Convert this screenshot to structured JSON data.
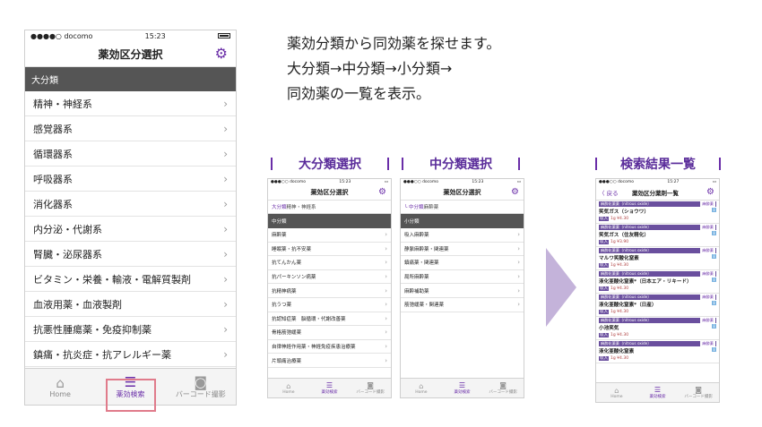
{
  "main_phone": {
    "status": {
      "carrier": "●●●●○ docomo",
      "time": "15:23"
    },
    "title": "薬効区分選択",
    "section": "大分類",
    "rows": [
      "精神・神経系",
      "感覚器系",
      "循環器系",
      "呼吸器系",
      "消化器系",
      "内分泌・代謝系",
      "腎臓・泌尿器系",
      "ビタミン・栄養・輸液・電解質製剤",
      "血液用薬・血液製剤",
      "抗悪性腫瘍薬・免疫抑制薬",
      "鎮痛・抗炎症・抗アレルギー薬"
    ],
    "tabs": [
      "Home",
      "薬効検索",
      "バーコード撮影"
    ]
  },
  "description": [
    "薬効分類から同効薬を探せます。",
    "大分類→中分類→小分類→",
    "同効薬の一覧を表示。"
  ],
  "headers": {
    "a": "大分類選択",
    "b": "中分類選択",
    "c": "検索結果一覧"
  },
  "phone_a": {
    "status": {
      "carrier": "●●●○○ docomo",
      "time": "15:23"
    },
    "title": "薬効区分選択",
    "crumb_prefix": "大分類",
    "crumb_rest": " 精神・神経系",
    "section": "中分類",
    "rows": [
      "麻酔薬",
      "睡眠薬・抗不安薬",
      "抗てんかん薬",
      "抗パーキンソン病薬",
      "抗精神病薬",
      "抗うつ薬",
      "抗認知症薬　脳循環・代謝改善薬",
      "骨格筋弛緩薬",
      "自律神経作用薬・神経免疫疾患治療薬",
      "片頭痛治療薬"
    ],
    "tabs": [
      "Home",
      "薬効検索",
      "バーコード撮影"
    ]
  },
  "phone_b": {
    "status": {
      "carrier": "●●●○○ docomo",
      "time": "15:23"
    },
    "title": "薬効区分選択",
    "crumb_prefix": "└ 中分類",
    "crumb_rest": " 麻酔薬",
    "section": "小分類",
    "rows": [
      "吸入麻酔薬",
      "静脈麻酔薬・関連薬",
      "鎮痛薬・関連薬",
      "局所麻酔薬",
      "麻酔補助薬",
      "筋弛緩薬・関連薬"
    ],
    "tabs": [
      "Home",
      "薬効検索",
      "バーコード撮影"
    ]
  },
  "phone_c": {
    "status": {
      "carrier": "●●●○○ docomo",
      "time": "15:27"
    },
    "back": "〈 戻る",
    "title": "薬効区分薬剤一覧",
    "results": [
      {
        "cat": "麻酔化薬薬（nitrous oxide）",
        "tag": "麻酔薬",
        "name": "笑気ガス（ショウワ）",
        "price": "¥4.30"
      },
      {
        "cat": "麻酔化薬薬（nitrous oxide）",
        "tag": "麻酔薬",
        "name": "笑気ガス（住友精化）",
        "price": "¥3.90"
      },
      {
        "cat": "麻酔化薬薬（nitrous oxide）",
        "tag": "麻酔薬",
        "name": "マルワ笑酸化窒素",
        "price": "¥4.30"
      },
      {
        "cat": "麻酔化薬薬（nitrous oxide）",
        "tag": "麻酔薬",
        "name": "液化亜酸化窒素*（日本エア・リキード）",
        "price": "¥4.30"
      },
      {
        "cat": "麻酔化薬薬（nitrous oxide）",
        "tag": "麻酔薬",
        "name": "液化亜酸化窒素*（日産）",
        "price": "¥4.30"
      },
      {
        "cat": "麻酔化薬薬（nitrous oxide）",
        "tag": "麻酔薬",
        "name": "小池笑気",
        "price": "¥4.30"
      },
      {
        "cat": "麻酔化薬薬（nitrous oxide）",
        "tag": "麻酔薬",
        "name": "液化亜酸化窒素",
        "price": "¥4.30"
      }
    ],
    "unit": "1g",
    "badge": "収入",
    "tabs": [
      "Home",
      "薬効検索",
      "バーコード撮影"
    ]
  }
}
